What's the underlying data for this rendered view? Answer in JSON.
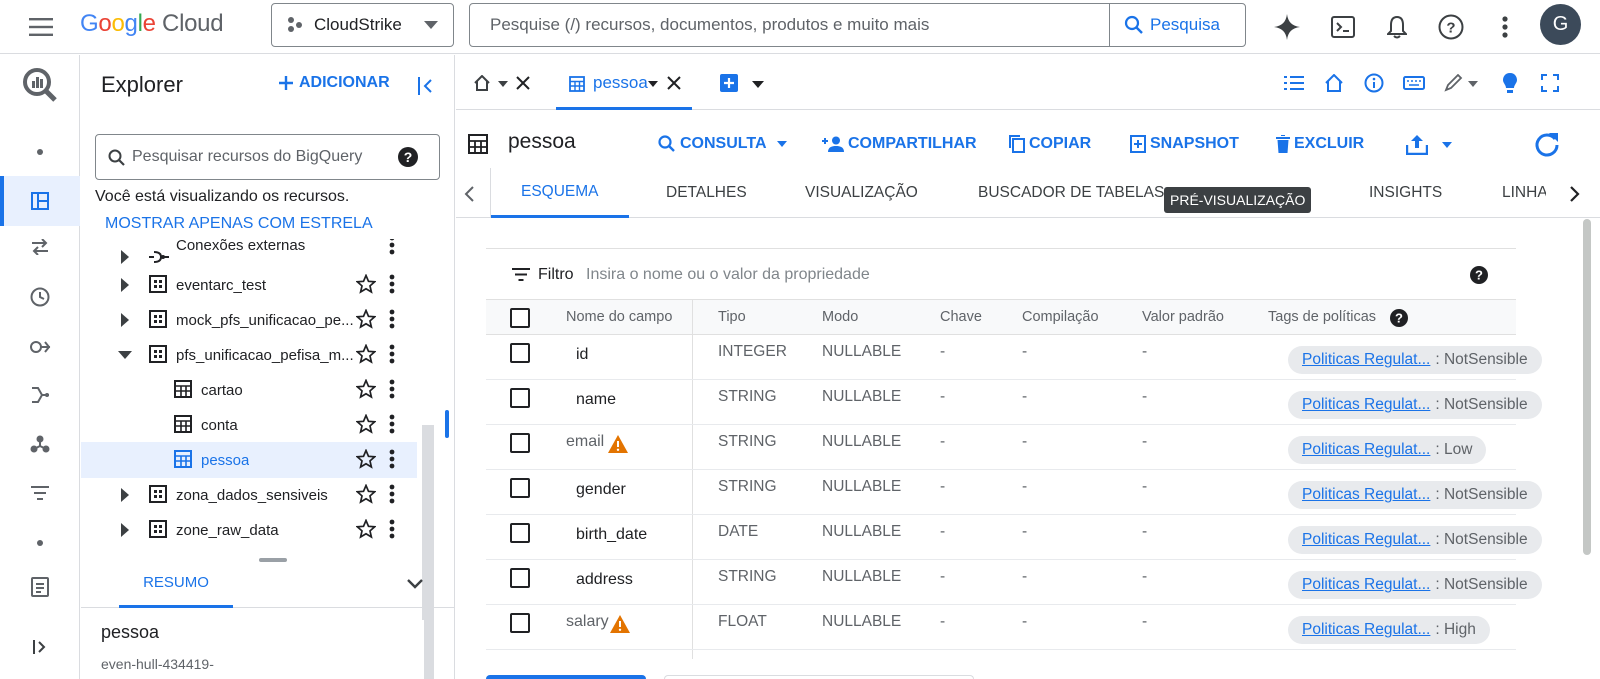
{
  "header": {
    "logo_google": "Google",
    "logo_cloud": "Cloud",
    "project_name": "CloudStrike",
    "search_placeholder": "Pesquise (/) recursos, documentos, produtos e muito mais",
    "search_button": "Pesquisa",
    "avatar_initial": "G"
  },
  "explorer": {
    "title": "Explorer",
    "add_label": "ADICIONAR",
    "search_placeholder": "Pesquisar recursos do BigQuery",
    "viewing_text": "Você está visualizando os recursos.",
    "starred_link": "MOSTRAR APENAS COM ESTRELA",
    "tree": [
      {
        "label": "Conexões externas"
      },
      {
        "label": "eventarc_test"
      },
      {
        "label": "mock_pfs_unificacao_pe..."
      },
      {
        "label": "pfs_unificacao_pefisa_m..."
      },
      {
        "label": "cartao"
      },
      {
        "label": "conta"
      },
      {
        "label": "pessoa"
      },
      {
        "label": "zona_dados_sensiveis"
      },
      {
        "label": "zone_raw_data"
      }
    ],
    "summary_tab": "RESUMO",
    "summary_name": "pessoa",
    "summary_project": "even-hull-434419-"
  },
  "main": {
    "active_tab_label": "pessoa",
    "table_title": "pessoa",
    "actions": {
      "query": "CONSULTA",
      "share": "COMPARTILHAR",
      "copy": "COPIAR",
      "snapshot": "SNAPSHOT",
      "delete": "EXCLUIR"
    },
    "subtabs": {
      "schema": "ESQUEMA",
      "details": "DETALHES",
      "visualization": "VISUALIZAÇÃO",
      "table_explorer": "BUSCADOR DE TABELAS",
      "preview_badge": "PRÉ-VISUALIZAÇÃO",
      "insights": "INSIGHTS",
      "lineage": "LINHA"
    },
    "filter_label": "Filtro",
    "filter_placeholder": "Insira o nome ou o valor da propriedade",
    "columns": [
      "Nome do campo",
      "Tipo",
      "Modo",
      "Chave",
      "Compilação",
      "Valor padrão",
      "Tags de políticas"
    ],
    "rows": [
      {
        "name": "id",
        "type": "INTEGER",
        "mode": "NULLABLE",
        "key": "-",
        "collation": "-",
        "default": "-",
        "policy": "Politicas Regulat...",
        "policy_value": ": NotSensible"
      },
      {
        "name": "name",
        "type": "STRING",
        "mode": "NULLABLE",
        "key": "-",
        "collation": "-",
        "default": "-",
        "policy": "Politicas Regulat...",
        "policy_value": ": NotSensible"
      },
      {
        "name": "email",
        "type": "STRING",
        "mode": "NULLABLE",
        "key": "-",
        "collation": "-",
        "default": "-",
        "policy": "Politicas Regulat...",
        "policy_value": ": Low"
      },
      {
        "name": "gender",
        "type": "STRING",
        "mode": "NULLABLE",
        "key": "-",
        "collation": "-",
        "default": "-",
        "policy": "Politicas Regulat...",
        "policy_value": ": NotSensible"
      },
      {
        "name": "birth_date",
        "type": "DATE",
        "mode": "NULLABLE",
        "key": "-",
        "collation": "-",
        "default": "-",
        "policy": "Politicas Regulat...",
        "policy_value": ": NotSensible"
      },
      {
        "name": "address",
        "type": "STRING",
        "mode": "NULLABLE",
        "key": "-",
        "collation": "-",
        "default": "-",
        "policy": "Politicas Regulat...",
        "policy_value": ": NotSensible"
      },
      {
        "name": "salary",
        "type": "FLOAT",
        "mode": "NULLABLE",
        "key": "-",
        "collation": "-",
        "default": "-",
        "policy": "Politicas Regulat...",
        "policy_value": ": High"
      }
    ]
  },
  "colors": {
    "accent": "#1a73e8",
    "warning": "#e37400",
    "text": "#202124",
    "muted": "#5f6368"
  }
}
